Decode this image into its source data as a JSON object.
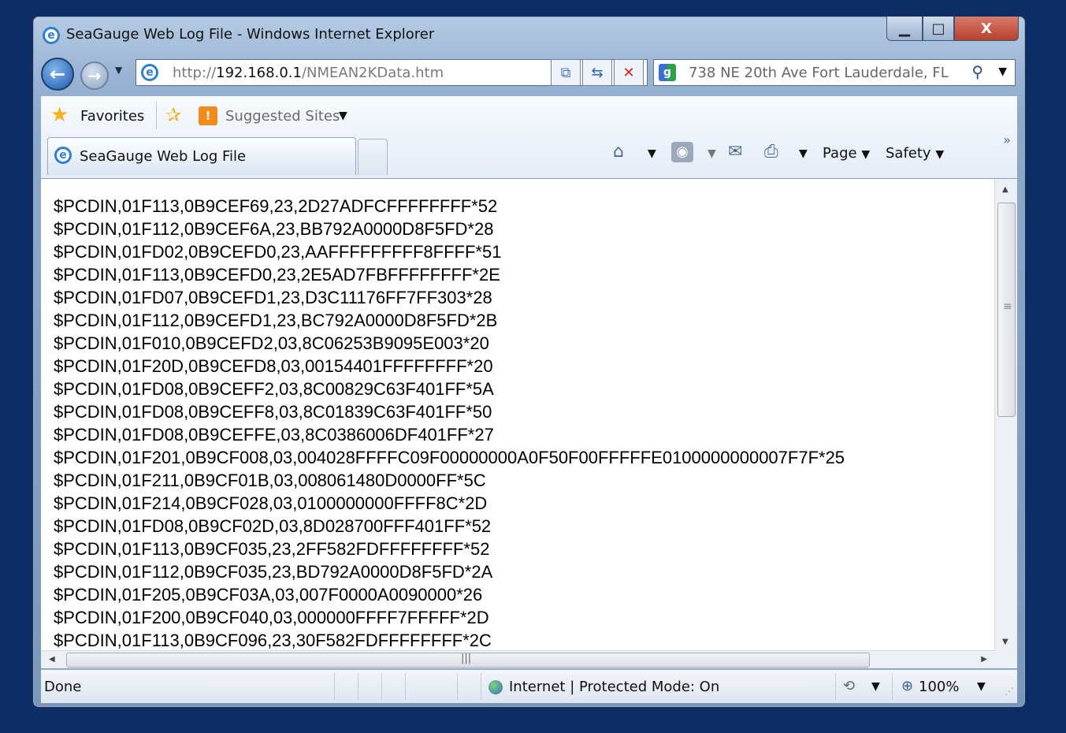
{
  "window": {
    "title": "SeaGauge Web Log File - Windows Internet Explorer",
    "buttons": {
      "minimize": "▁",
      "maximize": "□",
      "close": "X"
    }
  },
  "navigation": {
    "address_prefix": "http://",
    "address_host": "192.168.0.1",
    "address_path": "/NMEAN2KData.htm",
    "search_text": "738 NE 20th Ave Fort Lauderdale, FL"
  },
  "favorites_bar": {
    "favorites_label": "Favorites",
    "suggested_sites_label": "Suggested Sites"
  },
  "tab": {
    "label": "SeaGauge Web Log File"
  },
  "command_bar": {
    "page_label": "Page",
    "safety_label": "Safety"
  },
  "content": {
    "lines": [
      "$PCDIN,01F113,0B9CEF69,23,2D27ADFCFFFFFFFF*52",
      "$PCDIN,01F112,0B9CEF6A,23,BB792A0000D8F5FD*28",
      "$PCDIN,01FD02,0B9CEFD0,23,AAFFFFFFFFF8FFFF*51",
      "$PCDIN,01F113,0B9CEFD0,23,2E5AD7FBFFFFFFFF*2E",
      "$PCDIN,01FD07,0B9CEFD1,23,D3C11176FF7FF303*28",
      "$PCDIN,01F112,0B9CEFD1,23,BC792A0000D8F5FD*2B",
      "$PCDIN,01F010,0B9CEFD2,03,8C06253B9095E003*20",
      "$PCDIN,01F20D,0B9CEFD8,03,00154401FFFFFFFF*20",
      "$PCDIN,01FD08,0B9CEFF2,03,8C00829C63F401FF*5A",
      "$PCDIN,01FD08,0B9CEFF8,03,8C01839C63F401FF*50",
      "$PCDIN,01FD08,0B9CEFFE,03,8C0386006DF401FF*27",
      "$PCDIN,01F201,0B9CF008,03,004028FFFFC09F00000000A0F50F00FFFFFE0100000000007F7F*25",
      "$PCDIN,01F211,0B9CF01B,03,008061480D0000FF*5C",
      "$PCDIN,01F214,0B9CF028,03,0100000000FFFF8C*2D",
      "$PCDIN,01FD08,0B9CF02D,03,8D028700FFF401FF*52",
      "$PCDIN,01F113,0B9CF035,23,2FF582FDFFFFFFFF*52",
      "$PCDIN,01F112,0B9CF035,23,BD792A0000D8F5FD*2A",
      "$PCDIN,01F205,0B9CF03A,03,007F0000A0090000*26",
      "$PCDIN,01F200,0B9CF040,03,000000FFFF7FFFFF*2D",
      "$PCDIN,01F113,0B9CF096,23,30F582FDFFFFFFFF*2C"
    ]
  },
  "status_bar": {
    "status_text": "Done",
    "zone_text": "Internet | Protected Mode: On",
    "zoom_text": "100%"
  },
  "colors": {
    "desktop": "#0d2d66",
    "chrome": "#9fb8d6",
    "close_button": "#c54a36"
  },
  "icons": [
    "ie-logo-icon",
    "back-arrow-icon",
    "forward-arrow-icon",
    "compat-view-icon",
    "refresh-icon",
    "stop-icon",
    "google-icon",
    "search-icon",
    "star-icon",
    "add-favorite-icon",
    "suggested-sites-icon",
    "home-icon",
    "rss-feed-icon",
    "mail-icon",
    "print-icon",
    "globe-icon",
    "zoom-icon"
  ]
}
